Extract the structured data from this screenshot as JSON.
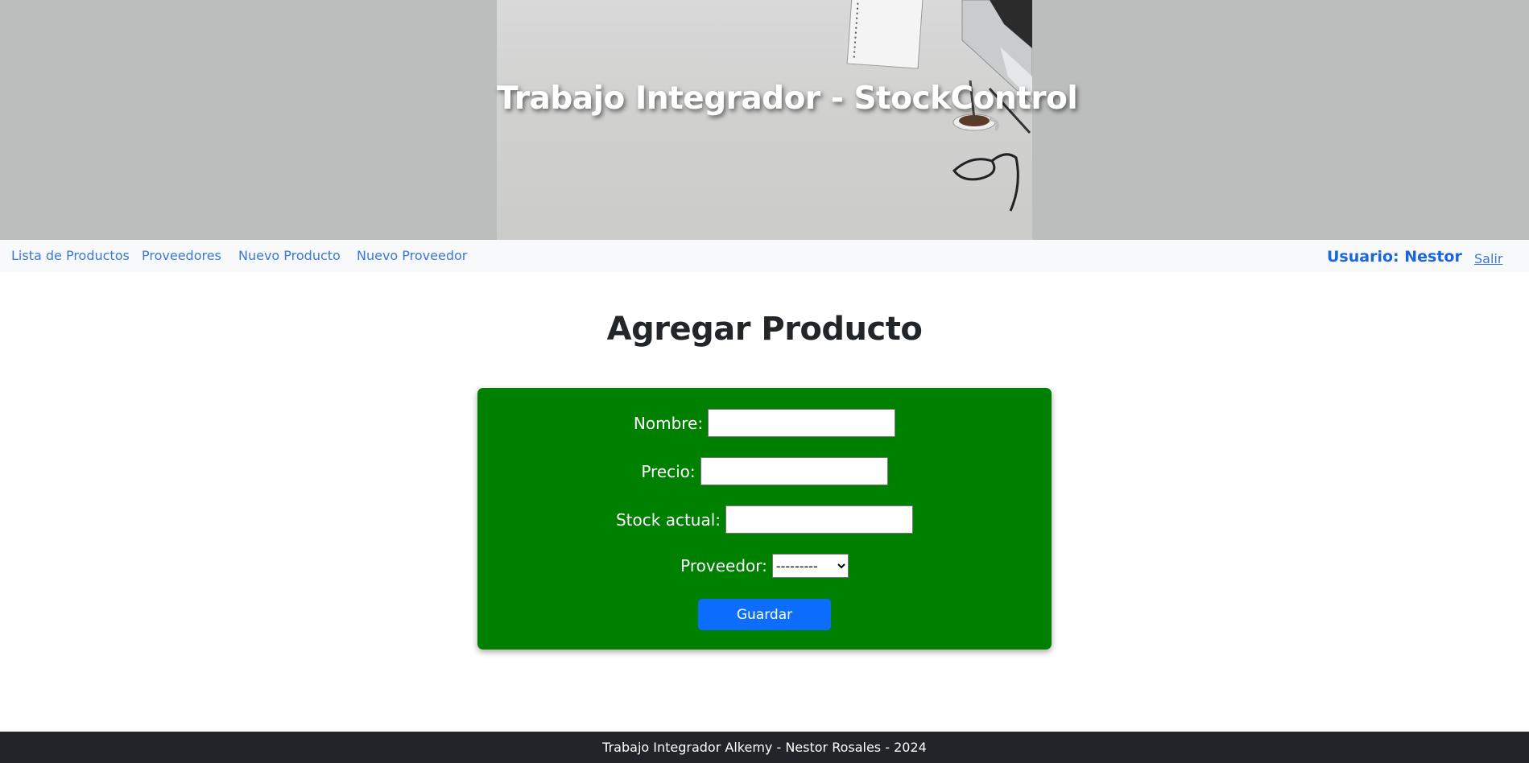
{
  "header": {
    "title": "Trabajo Integrador - StockControl"
  },
  "nav": {
    "items": [
      {
        "label": "Lista de Productos"
      },
      {
        "label": "Proveedores"
      },
      {
        "label": "Nuevo Producto"
      },
      {
        "label": "Nuevo Proveedor"
      }
    ],
    "user_label": "Usuario: Nestor",
    "logout_label": "Salir"
  },
  "main": {
    "title": "Agregar Producto",
    "form": {
      "nombre_label": "Nombre:",
      "nombre_value": "",
      "precio_label": "Precio:",
      "precio_value": "",
      "stock_label": "Stock actual:",
      "stock_value": "",
      "proveedor_label": "Proveedor:",
      "proveedor_selected": "---------",
      "save_label": "Guardar"
    }
  },
  "footer": {
    "text": "Trabajo Integrador Alkemy - Nestor Rosales - 2024"
  },
  "colors": {
    "form_background": "#008000",
    "primary_button": "#0d6efd",
    "link": "#3b78d8",
    "footer_background": "#212529",
    "banner_background": "#bcbebd"
  }
}
